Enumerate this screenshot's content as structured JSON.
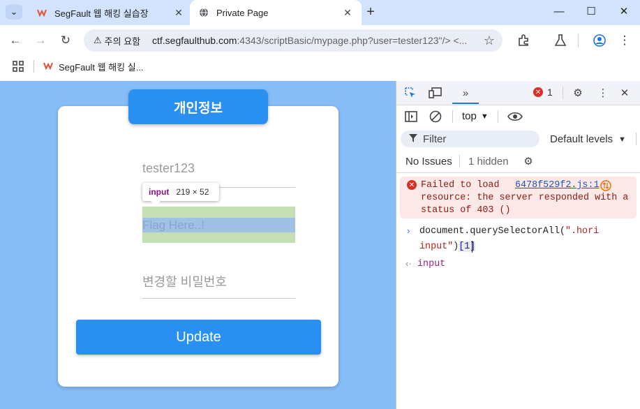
{
  "browser": {
    "tabs": [
      {
        "title": "SegFault 웹 해킹 실습장",
        "active": false
      },
      {
        "title": "Private Page",
        "active": true
      }
    ],
    "address": {
      "security_label": "주의 요함",
      "url_host": "ctf.segfaulthub.com",
      "url_rest": ":4343/scriptBasic/mypage.php?user=tester123\"/> <..."
    },
    "bookmarks": [
      {
        "label": "SegFault 웹 해킹 실..."
      }
    ]
  },
  "page": {
    "card_title": "개인정보",
    "username_value": "tester123",
    "flag_placeholder": "Flag Here..!",
    "password_placeholder": "변경할 비밀번호",
    "update_label": "Update",
    "inspect_tooltip": {
      "tag": "input",
      "dims": "219 × 52"
    }
  },
  "devtools": {
    "error_count": "1",
    "context": "top",
    "filter_placeholder": "Filter",
    "levels_label": "Default levels",
    "issues_label": "No Issues",
    "hidden_label": "1 hidden",
    "console": {
      "error": {
        "text1": "Failed to load",
        "link": "6478f529f2.js:1",
        "text2": "resource: the server responded with a",
        "text3": "status of 403 ()"
      },
      "input_line1_a": "document.querySelectorAll(",
      "input_line1_b": "\".hori",
      "input_line2_a": "input\"",
      "input_line2_b": ")",
      "input_line2_c": "[1]",
      "result": "input"
    }
  },
  "colors": {
    "page_bg": "#86bdf6",
    "accent_button": "#2990f2",
    "error_bg": "#fce8e6"
  }
}
